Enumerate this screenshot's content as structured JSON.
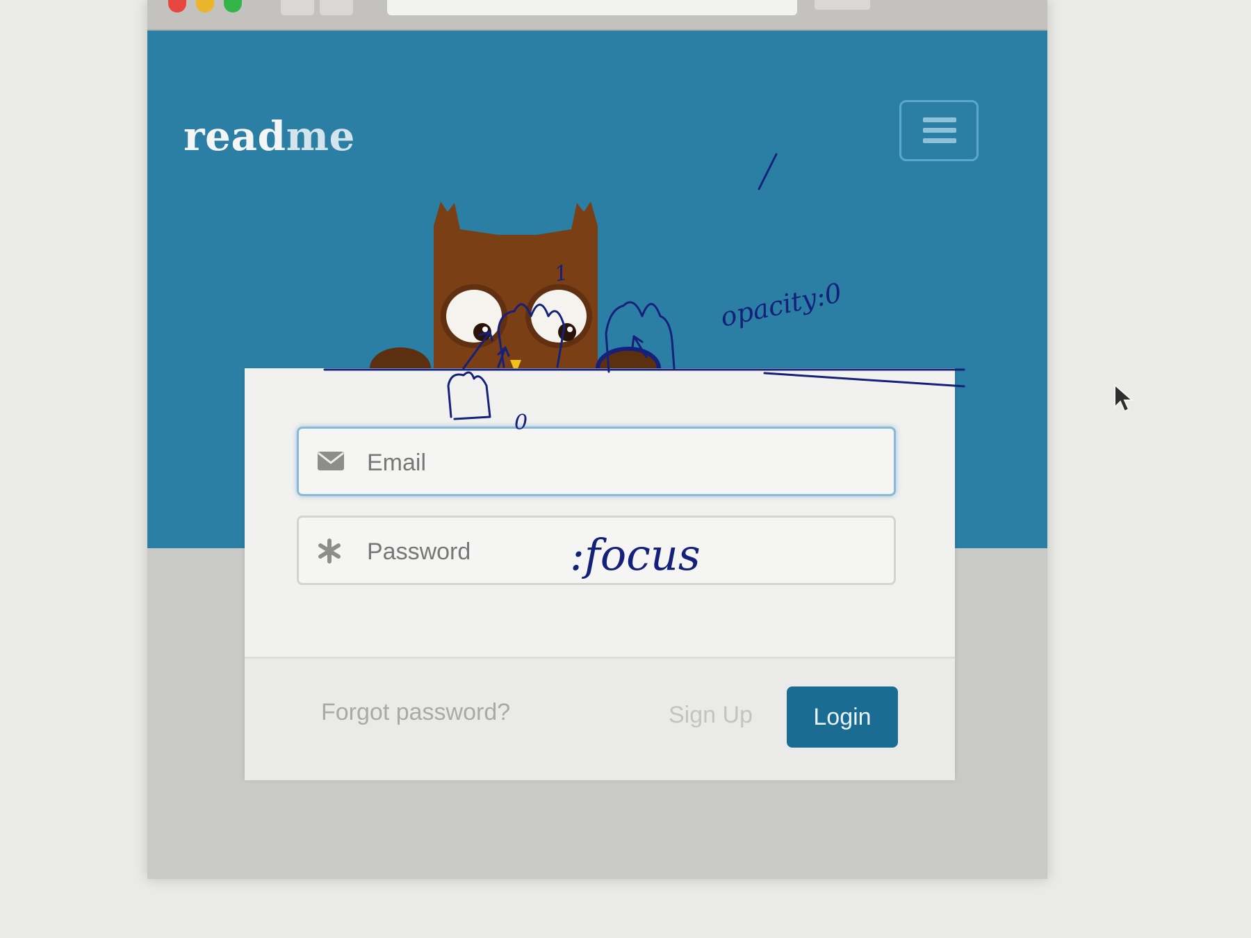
{
  "colors": {
    "brand": "#2b7ea4",
    "login_button": "#1b6c93",
    "owl_body": "#7a3f15",
    "annotation_ink": "#14207a"
  },
  "header": {
    "logo_bold": "read",
    "logo_light": "me",
    "menu_icon": "hamburger-menu-icon"
  },
  "form": {
    "email": {
      "placeholder": "Email",
      "icon": "envelope-icon"
    },
    "password": {
      "placeholder": "Password",
      "icon": "asterisk-icon"
    }
  },
  "footer": {
    "forgot_label": "Forgot password?",
    "signup_label": "Sign Up",
    "login_label": "Login"
  },
  "annotations": {
    "label_one": "1",
    "label_zero": "0",
    "opacity_note": "opacity:0",
    "focus_note": ":focus"
  }
}
